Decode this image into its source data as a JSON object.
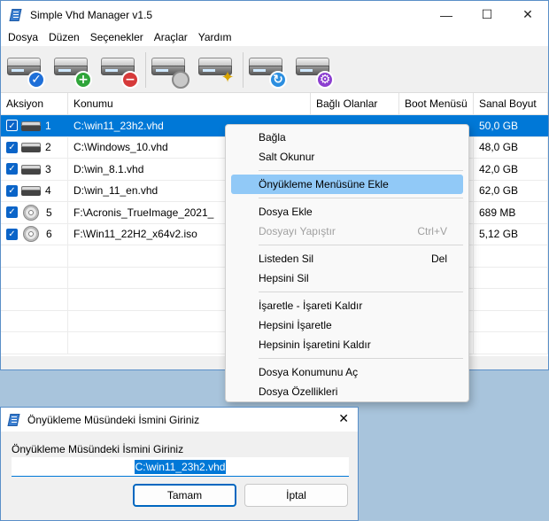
{
  "window": {
    "title": "Simple Vhd Manager v1.5",
    "controls": {
      "minimize": "—",
      "maximize": "☐",
      "close": "✕"
    }
  },
  "menu": [
    "Dosya",
    "Düzen",
    "Seçenekler",
    "Araçlar",
    "Yardım"
  ],
  "toolbar": [
    {
      "icon": "drive-check-icon",
      "badge": "✓",
      "badge_color": "#1e6fd8"
    },
    {
      "icon": "drive-add-icon",
      "badge": "+",
      "badge_color": "#2fa53a"
    },
    {
      "icon": "drive-remove-icon",
      "badge": "−",
      "badge_color": "#d63a3a"
    },
    {
      "icon": "drive-mouse-icon",
      "badge": "",
      "badge_color": "#c9c9c9"
    },
    {
      "icon": "drive-wand-icon",
      "badge": "✦",
      "badge_color": "#d9a400"
    },
    {
      "icon": "drive-refresh-icon",
      "badge": "↻",
      "badge_color": "#2d8fe0"
    },
    {
      "icon": "drive-settings-icon",
      "badge": "⚙",
      "badge_color": "#8c3fd0"
    }
  ],
  "table": {
    "columns": [
      "Aksiyon",
      "Konumu",
      "Bağlı Olanlar",
      "Boot Menüsü",
      "Sanal Boyut"
    ],
    "rows": [
      {
        "num": "1",
        "path": "C:\\win11_23h2.vhd",
        "size": "50,0 GB",
        "type": "hdd",
        "selected": true
      },
      {
        "num": "2",
        "path": "C:\\Windows_10.vhd",
        "size": "48,0 GB",
        "type": "hdd",
        "selected": false
      },
      {
        "num": "3",
        "path": "D:\\win_8.1.vhd",
        "size": "42,0 GB",
        "type": "hdd",
        "selected": false
      },
      {
        "num": "4",
        "path": "D:\\win_11_en.vhd",
        "size": "62,0 GB",
        "type": "hdd",
        "selected": false
      },
      {
        "num": "5",
        "path": "F:\\Acronis_TrueImage_2021_",
        "size": "689 MB",
        "type": "disc",
        "selected": false
      },
      {
        "num": "6",
        "path": "F:\\Win11_22H2_x64v2.iso",
        "size": "5,12 GB",
        "type": "disc",
        "selected": false
      }
    ]
  },
  "context_menu": {
    "groups": [
      [
        {
          "label": "Bağla"
        },
        {
          "label": "Salt Okunur"
        }
      ],
      [
        {
          "label": "Önyükleme Menüsüne Ekle",
          "highlighted": true
        }
      ],
      [
        {
          "label": "Dosya Ekle"
        },
        {
          "label": "Dosyayı Yapıştır",
          "shortcut": "Ctrl+V",
          "disabled": true
        }
      ],
      [
        {
          "label": "Listeden Sil",
          "shortcut": "Del"
        },
        {
          "label": "Hepsini Sil"
        }
      ],
      [
        {
          "label": "İşaretle - İşareti Kaldır"
        },
        {
          "label": "Hepsini İşaretle"
        },
        {
          "label": "Hepsinin İşaretini Kaldır"
        }
      ],
      [
        {
          "label": "Dosya Konumunu Aç"
        },
        {
          "label": "Dosya Özellikleri"
        }
      ]
    ]
  },
  "dialog": {
    "title": "Önyükleme Müsündeki İsmini Giriniz",
    "close": "✕",
    "label": "Önyükleme Müsündeki İsmini Giriniz",
    "input_value": "C:\\win11_23h2.vhd",
    "ok_label": "Tamam",
    "cancel_label": "İptal"
  }
}
